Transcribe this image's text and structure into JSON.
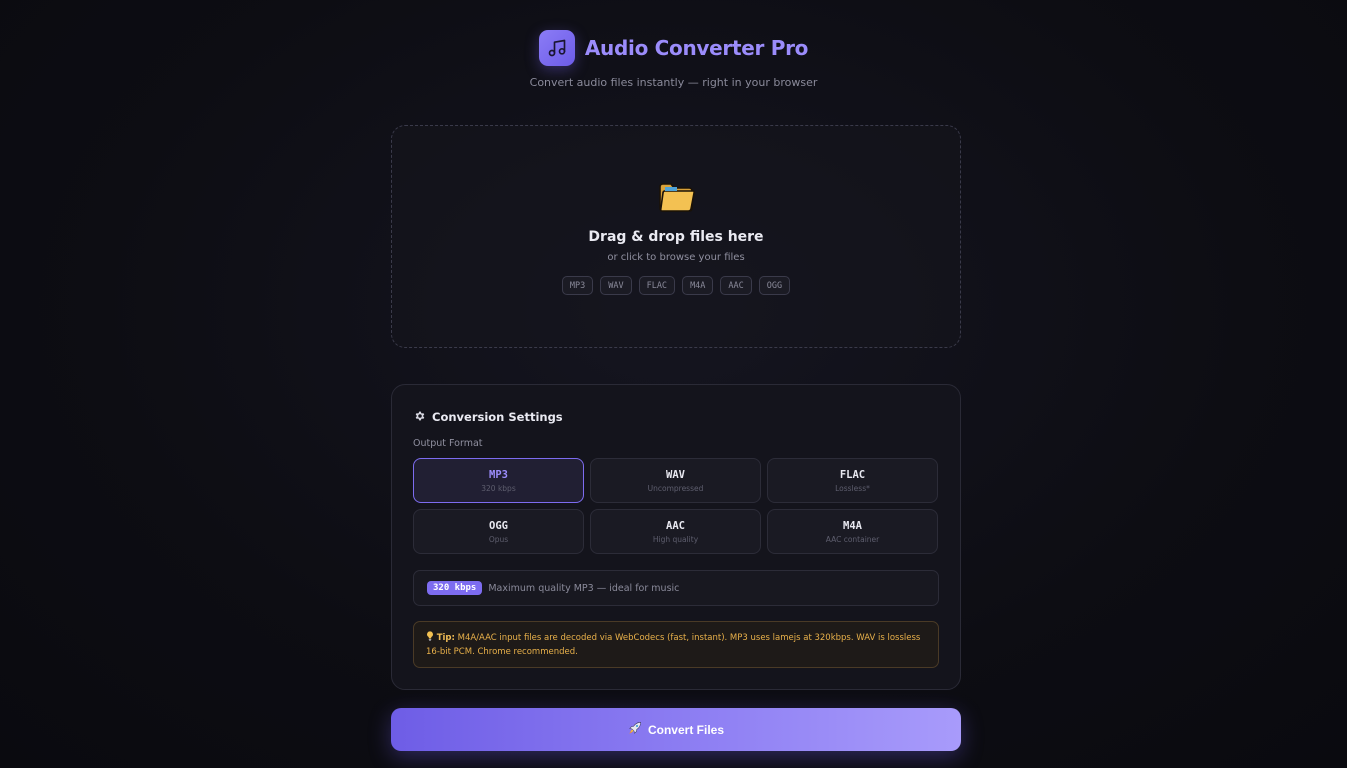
{
  "header": {
    "title": "Audio Converter Pro",
    "subtitle": "Convert audio files instantly — right in your browser",
    "logo_icon": "music-note-icon"
  },
  "dropzone": {
    "icon": "folder-icon",
    "title": "Drag & drop files here",
    "subtitle": "or click to browse your files",
    "formats": [
      "MP3",
      "WAV",
      "FLAC",
      "M4A",
      "AAC",
      "OGG"
    ]
  },
  "settings": {
    "icon": "gear-icon",
    "title": "Conversion Settings",
    "output_label": "Output Format",
    "formats": [
      {
        "name": "MP3",
        "desc": "320 kbps",
        "active": true
      },
      {
        "name": "WAV",
        "desc": "Uncompressed",
        "active": false
      },
      {
        "name": "FLAC",
        "desc": "Lossless*",
        "active": false
      },
      {
        "name": "OGG",
        "desc": "Opus",
        "active": false
      },
      {
        "name": "AAC",
        "desc": "High quality",
        "active": false
      },
      {
        "name": "M4A",
        "desc": "AAC container",
        "active": false
      }
    ],
    "quality_badge": "320 kbps",
    "quality_text": "Maximum quality MP3 — ideal for music",
    "tip_icon": "lightbulb-icon",
    "tip_label": "Tip:",
    "tip_text": "M4A/AAC input files are decoded via WebCodecs (fast, instant). MP3 uses lamejs at 320kbps. WAV is lossless 16-bit PCM. Chrome recommended."
  },
  "convert_button": {
    "icon": "rocket-icon",
    "label": "Convert Files"
  },
  "colors": {
    "accent": "#7d6cf0",
    "tip": "#e8b04a",
    "background": "#0d0d13"
  }
}
